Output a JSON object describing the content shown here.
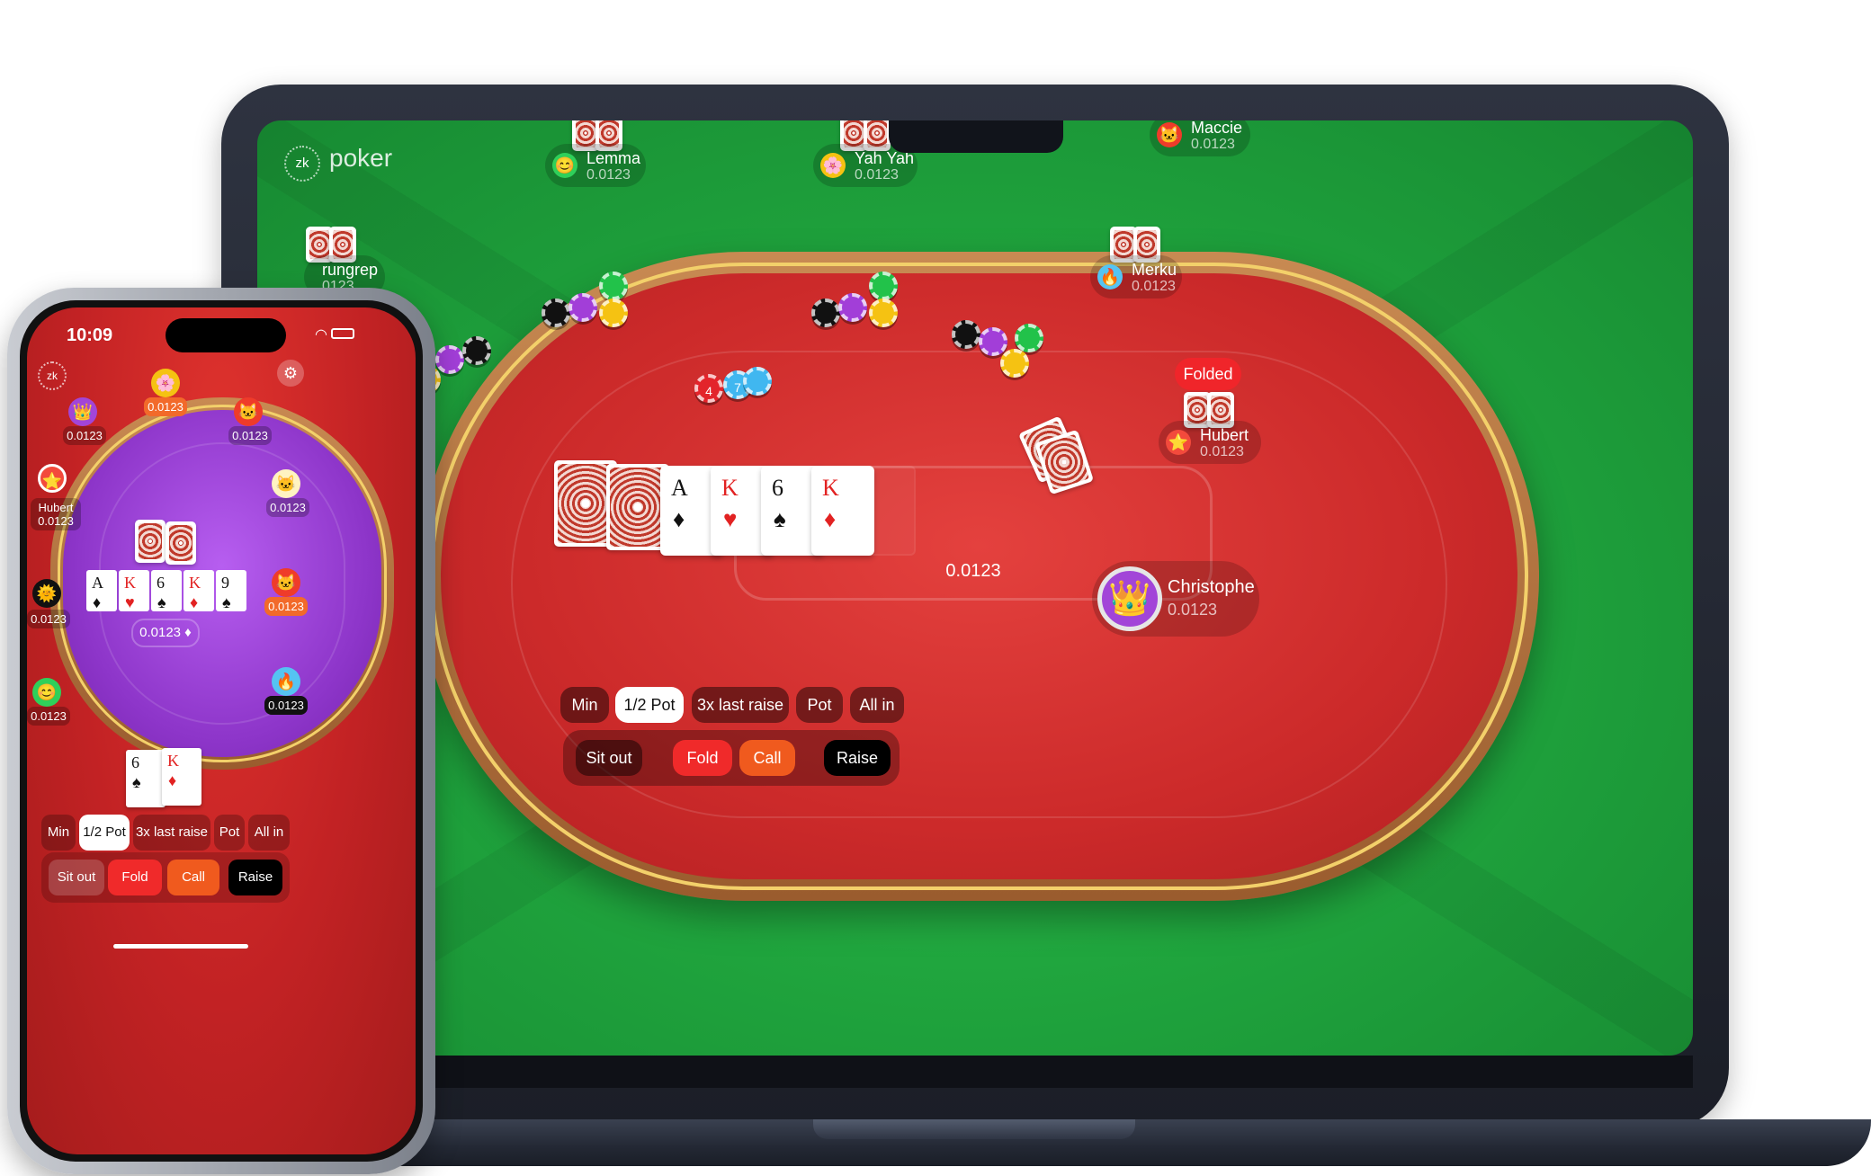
{
  "desktop": {
    "logo": {
      "mark": "zk",
      "text": "poker"
    },
    "players": {
      "lemma": {
        "name": "Lemma",
        "balance": "0.0123",
        "avatar": "😊"
      },
      "yahyah": {
        "name": "Yah Yah",
        "balance": "0.0123",
        "avatar": "🌸"
      },
      "maccie": {
        "name": "Maccie",
        "balance": "0.0123",
        "avatar": "🐱"
      },
      "rungrep": {
        "name": "rungrep",
        "balance": "0123"
      },
      "merku": {
        "name": "Merku",
        "balance": "0.0123",
        "avatar": "🔥"
      },
      "hubert": {
        "name": "Hubert",
        "balance": "0.0123",
        "avatar": "⭐",
        "status": "Folded"
      },
      "christophe": {
        "name": "Christophe",
        "balance": "0.0123",
        "avatar": "👑"
      }
    },
    "pot": {
      "chips": [
        "4",
        "7"
      ],
      "amount": "0.0123"
    },
    "community_cards": [
      {
        "rank": "A",
        "suit": "♦",
        "color": "#111111"
      },
      {
        "rank": "K",
        "suit": "♥",
        "color": "#e22222"
      },
      {
        "rank": "6",
        "suit": "♠",
        "color": "#111111"
      },
      {
        "rank": "K",
        "suit": "♦",
        "color": "#e22222"
      }
    ],
    "bet_options": [
      "Min",
      "1/2 Pot",
      "3x last raise",
      "Pot",
      "All in"
    ],
    "selected_bet": "1/2 Pot",
    "actions": {
      "sit_out": "Sit out",
      "fold": "Fold",
      "call": "Call",
      "raise": "Raise"
    }
  },
  "phone": {
    "status": {
      "time": "10:09",
      "icons": "wifi-icon battery-icon"
    },
    "logo_mark": "zk",
    "players": [
      {
        "avatar": "🌸",
        "balance": "0.0123"
      },
      {
        "avatar": "👑",
        "balance": "0.0123"
      },
      {
        "avatar": "🐱",
        "balance": "0.0123"
      },
      {
        "avatar": "⭐",
        "name": "Hubert",
        "balance": "0.0123"
      },
      {
        "avatar": "🐱",
        "balance": "0.0123"
      },
      {
        "avatar": "🌞",
        "balance": "0.0123"
      },
      {
        "avatar": "🐱",
        "balance": "0.0123"
      },
      {
        "avatar": "😊",
        "balance": "0.0123"
      },
      {
        "avatar": "🔥",
        "balance": "0.0123"
      }
    ],
    "community_cards": [
      {
        "rank": "A",
        "suit": "♦",
        "color": "#111111"
      },
      {
        "rank": "K",
        "suit": "♥",
        "color": "#e22222"
      },
      {
        "rank": "6",
        "suit": "♠",
        "color": "#111111"
      },
      {
        "rank": "K",
        "suit": "♦",
        "color": "#e22222"
      },
      {
        "rank": "9",
        "suit": "♠",
        "color": "#111111"
      }
    ],
    "pot_amount": "0.0123 ♦",
    "hand_cards": [
      {
        "rank": "6",
        "suit": "♠",
        "color": "#111111"
      },
      {
        "rank": "K",
        "suit": "♦",
        "color": "#e22222"
      }
    ],
    "bet_options": [
      "Min",
      "1/2 Pot",
      "3x last raise",
      "Pot",
      "All in"
    ],
    "selected_bet": "1/2 Pot",
    "actions": {
      "sit_out": "Sit out",
      "fold": "Fold",
      "call": "Call",
      "raise": "Raise"
    }
  }
}
